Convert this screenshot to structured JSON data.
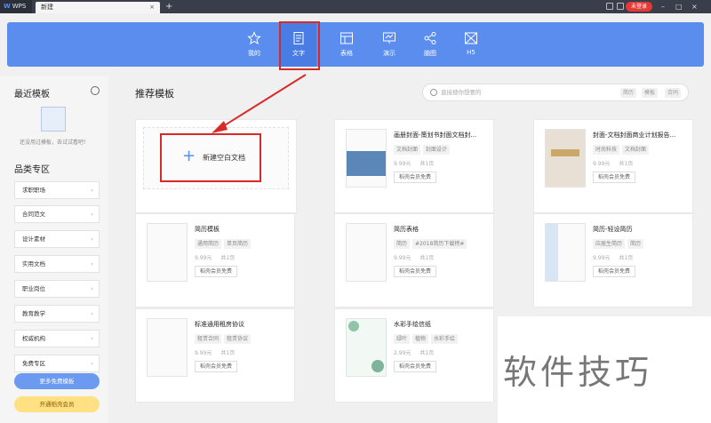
{
  "titlebar": {
    "app_name": "WPS",
    "tab_label": "新建",
    "close_glyph": "×",
    "add_glyph": "+",
    "login_label": "未登录",
    "minimize_glyph": "–",
    "maximize_glyph": "□",
    "close_window_glyph": "×"
  },
  "categories": {
    "items": [
      {
        "label": "我的",
        "icon": "star-icon"
      },
      {
        "label": "文字",
        "icon": "document-icon"
      },
      {
        "label": "表格",
        "icon": "table-icon"
      },
      {
        "label": "演示",
        "icon": "presentation-icon"
      },
      {
        "label": "脑图",
        "icon": "mindmap-icon"
      },
      {
        "label": "H5",
        "icon": "image-icon"
      }
    ],
    "active": "文字"
  },
  "sidebar": {
    "recent_title": "最近模板",
    "recent_empty_text": "还没用过模板，去试试看吧！",
    "category_title": "品类专区",
    "items": [
      {
        "label": "求职职场"
      },
      {
        "label": "合同范文"
      },
      {
        "label": "设计素材"
      },
      {
        "label": "实用文档"
      },
      {
        "label": "职业岗位"
      },
      {
        "label": "教育教学"
      },
      {
        "label": "权威机构"
      },
      {
        "label": "免费专区"
      }
    ],
    "chevron": "›",
    "more_free_label": "更多免费模板",
    "vip_label": "开通稻壳会员"
  },
  "main": {
    "title": "推荐模板",
    "search_placeholder": "直接搜你想要的",
    "search_tags": [
      "简历",
      "模板",
      "合同"
    ],
    "blank_label": "新建空白文档",
    "blank_plus": "+"
  },
  "cards": [
    {
      "name": "画册封面-策划书封面文档封...",
      "tags": [
        "文档封面",
        "封面设计"
      ],
      "price": "9.99元",
      "pages": "共1页",
      "free": "稻壳会员免费"
    },
    {
      "name": "封面-文档封面商业计划报告...",
      "tags": [
        "时尚科技",
        "文档封面"
      ],
      "price": "9.99元",
      "pages": "共1页",
      "free": "稻壳会员免费"
    },
    {
      "name": "简历模板",
      "tags": [
        "通用简历",
        "单页简历"
      ],
      "price": "9.99元",
      "pages": "共1页",
      "free": "稻壳会员免费"
    },
    {
      "name": "简历表格",
      "tags": [
        "简历",
        "#2018简历下载榜#"
      ],
      "price": "9.99元",
      "pages": "共1页",
      "free": "稻壳会员免费"
    },
    {
      "name": "简历-轻设简历",
      "tags": [
        "应届生简历",
        "简历"
      ],
      "price": "9.99元",
      "pages": "共1页",
      "free": "稻壳会员免费"
    },
    {
      "name": "标准通用租房协议",
      "tags": [
        "租赁合同",
        "租赁协议"
      ],
      "price": "9.99元",
      "pages": "共1页",
      "free": "稻壳会员免费"
    },
    {
      "name": "水彩手绘信纸",
      "tags": [
        "绿叶",
        "植物",
        "水彩手绘"
      ],
      "price": "2.99元",
      "pages": "共1页",
      "free": "稻壳会员免费"
    }
  ],
  "watermark": "软件技巧",
  "colors": {
    "accent": "#5b8def",
    "highlight": "#d92a2a",
    "login_badge": "#e53935"
  }
}
